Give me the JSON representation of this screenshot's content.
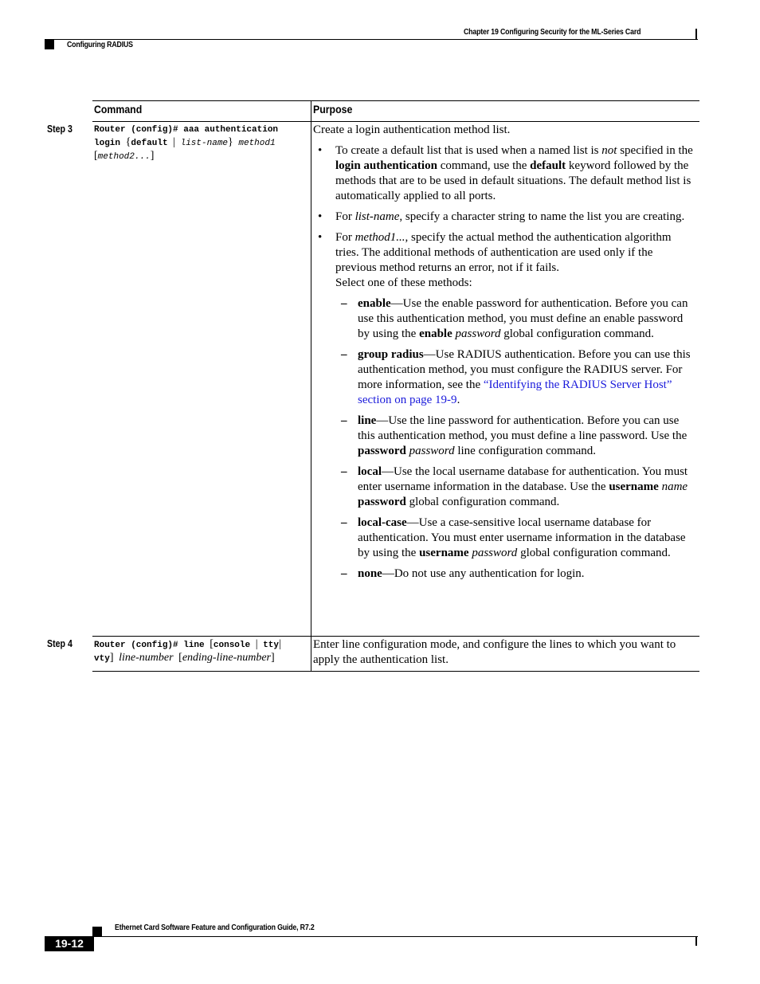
{
  "header": {
    "chapter_title": "Chapter 19 Configuring Security for the ML-Series Card",
    "section_title": "Configuring RADIUS"
  },
  "table": {
    "columns": [
      "Command",
      "Purpose"
    ],
    "rows": [
      {
        "step": "Step 3",
        "command": {
          "prompt": "Router (config)# aaa authentication",
          "kw_login": "login",
          "brace_open": "{",
          "kw_default": "default",
          "pipe": "|",
          "arg_list_name": "list-name",
          "brace_close": "}",
          "arg_method1": "method1",
          "bracket_open": "[",
          "arg_method2": "method2...",
          "bracket_close": "]"
        },
        "purpose": {
          "intro": "Create a login authentication method list.",
          "bullet1": {
            "t1": "To create a default list that is used when a named list is ",
            "i1": "not",
            "t2": " specified in the ",
            "b1": "login authentication",
            "t3": " command, use the ",
            "b2": "default",
            "t4": " keyword followed by the methods that are to be used in default situations. The default method list is automatically applied to all ports."
          },
          "bullet2": {
            "t1": "For ",
            "i1": "list-name",
            "t2": ", specify a character string to name the list you are creating."
          },
          "bullet3": {
            "t1": "For ",
            "i1": "method1...",
            "t2": ", specify the actual method the authentication algorithm tries. The additional methods of authentication are used only if the previous method returns an error, not if it fails."
          },
          "select_intro": "Select one of these methods:",
          "methods": {
            "enable": {
              "name": "enable",
              "t1": "—Use the enable password for authentication. Before you can use this authentication method, you must define an enable password by using the ",
              "b1": "enable",
              "i1": "password",
              "t2": " global configuration command."
            },
            "group_radius": {
              "name": "group radius",
              "t1": "—Use RADIUS authentication. Before you can use this authentication method, you must configure the RADIUS server. For more information, see the ",
              "link": "“Identifying the RADIUS Server Host” section on page 19-9",
              "t2": "."
            },
            "line": {
              "name": "line",
              "t1": "—Use the line password for authentication. Before you can use this authentication method, you must define a line password. Use the ",
              "b1": "password",
              "i1": "password",
              "t2": " line configuration command."
            },
            "local": {
              "name": "local",
              "t1": "—Use the local username database for authentication. You must enter username information in the database. Use the ",
              "b1": "username",
              "i1": "name",
              "b2": "password",
              "t2": " global configuration command."
            },
            "local_case": {
              "name": "local-case",
              "t1": "—Use a case-sensitive local username database for authentication. You must enter username information in the database by using the ",
              "b1": "username",
              "i1": "password",
              "t2": " global configuration command."
            },
            "none": {
              "name": "none",
              "t1": "—Do not use any authentication for login."
            }
          }
        }
      },
      {
        "step": "Step 4",
        "command": {
          "prompt": "Router (config)# ",
          "kw_line": "line",
          "bracket_open": "[",
          "kw_console": "console",
          "pipe": "|",
          "kw_tty": "tty",
          "kw_vty": "vty",
          "bracket_close": "]",
          "arg_line_number": "line-number",
          "opt_open": "[",
          "arg_ending": "ending-line-number",
          "opt_close": "]"
        },
        "purpose": {
          "text": "Enter line configuration mode, and configure the lines to which you want to apply the authentication list."
        }
      }
    ]
  },
  "bullet_symbol": "•",
  "dash_symbol": "–",
  "footer": {
    "guide_title": "Ethernet Card Software Feature and Configuration Guide, R7.2",
    "page_number": "19-12"
  }
}
